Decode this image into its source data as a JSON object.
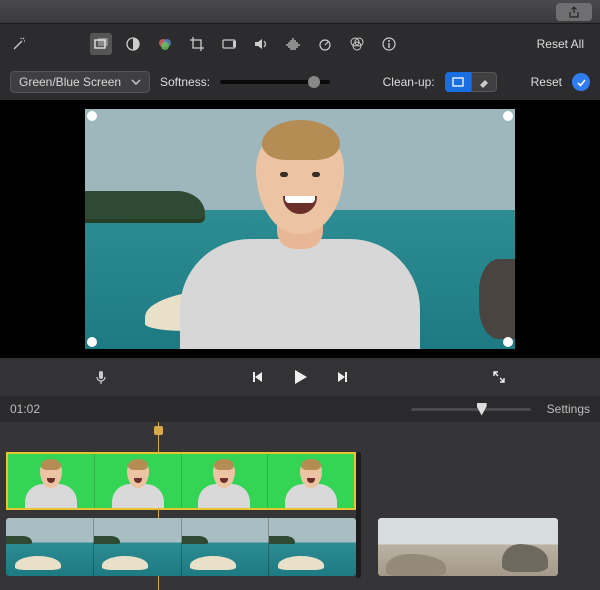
{
  "titlebar": {
    "share_icon": "share-icon"
  },
  "toolbar": {
    "wand_icon": "wand-icon",
    "icons": [
      {
        "name": "overlay-icon",
        "active": true
      },
      {
        "name": "color-balance-icon"
      },
      {
        "name": "color-correction-icon"
      },
      {
        "name": "crop-icon"
      },
      {
        "name": "stabilization-icon"
      },
      {
        "name": "volume-icon"
      },
      {
        "name": "noise-reduction-icon"
      },
      {
        "name": "speed-icon"
      },
      {
        "name": "color-filter-icon"
      },
      {
        "name": "info-icon"
      }
    ],
    "reset_all_label": "Reset All"
  },
  "adjust": {
    "overlay_mode": "Green/Blue Screen",
    "softness_label": "Softness:",
    "softness_value": 0.82,
    "cleanup_label": "Clean-up:",
    "cleanup_option_a": "crop-rect-icon",
    "cleanup_option_b": "eraser-icon",
    "reset_label": "Reset"
  },
  "viewer": {
    "subject": "person-smiling",
    "background": "tropical-beach"
  },
  "transport": {
    "mic_icon": "microphone-icon",
    "prev_icon": "skip-back-icon",
    "play_icon": "play-icon",
    "next_icon": "skip-forward-icon",
    "expand_icon": "expand-icon"
  },
  "timeline": {
    "timecode": "01:02",
    "settings_label": "Settings",
    "zoom_value": 0.55,
    "playhead_ratio": 0.43,
    "overlay_clip": {
      "frames": 4,
      "bg": "green-screen",
      "selected": true
    },
    "main_clip_a": {
      "frames": 4,
      "scene": "beach-rock"
    },
    "main_clip_b": {
      "scene": "rocky-shore"
    }
  },
  "colors": {
    "accent": "#2f7df0",
    "selection": "#e8c42e",
    "playhead": "#d6a94a"
  }
}
